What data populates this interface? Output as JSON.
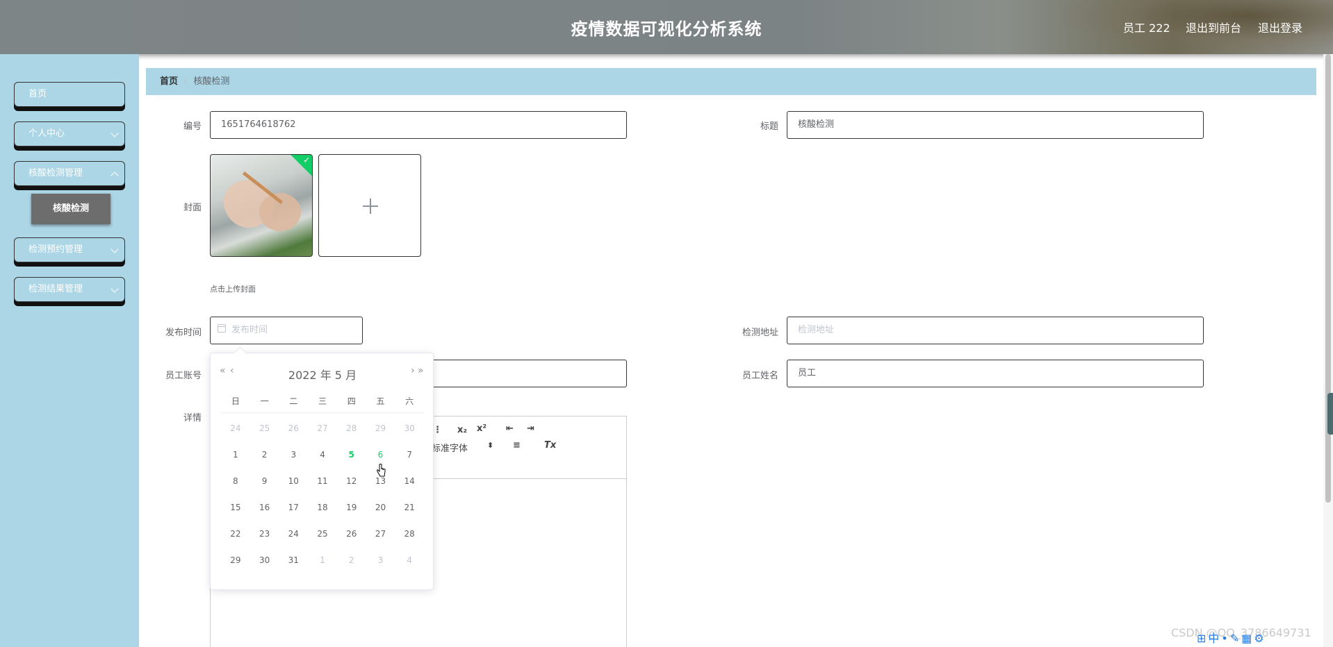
{
  "header": {
    "title": "疫情数据可视化分析系统",
    "user": "员工 222",
    "exit_front": "退出到前台",
    "logout": "退出登录"
  },
  "sidebar": {
    "items": [
      {
        "label": "首页"
      },
      {
        "label": "个人中心"
      },
      {
        "label": "核酸检测管理"
      },
      {
        "label": "检测预约管理"
      },
      {
        "label": "检测结果管理"
      }
    ],
    "active_sub": "核酸检测"
  },
  "breadcrumb": {
    "home": "首页",
    "current": "核酸检测"
  },
  "form": {
    "number_label": "编号",
    "number_value": "1651764618762",
    "title_label": "标题",
    "title_value": "核酸检测",
    "cover_label": "封面",
    "cover_tip": "点击上传封面",
    "publish_label": "发布时间",
    "publish_placeholder": "发布时间",
    "address_label": "检测地址",
    "address_placeholder": "检测地址",
    "account_label": "员工账号",
    "name_label": "员工姓名",
    "name_value": "员工",
    "detail_label": "详情"
  },
  "editor": {
    "font_select": "标准字体"
  },
  "datepicker": {
    "title": "2022 年  5 月",
    "weekdays": [
      "日",
      "一",
      "二",
      "三",
      "四",
      "五",
      "六"
    ],
    "weeks": [
      [
        "24",
        "25",
        "26",
        "27",
        "28",
        "29",
        "30"
      ],
      [
        "1",
        "2",
        "3",
        "4",
        "5",
        "6",
        "7"
      ],
      [
        "8",
        "9",
        "10",
        "11",
        "12",
        "13",
        "14"
      ],
      [
        "15",
        "16",
        "17",
        "18",
        "19",
        "20",
        "21"
      ],
      [
        "22",
        "23",
        "24",
        "25",
        "26",
        "27",
        "28"
      ],
      [
        "29",
        "30",
        "31",
        "1",
        "2",
        "3",
        "4"
      ]
    ],
    "today": "5"
  },
  "watermark": "CSDN @QQ_3786649731",
  "colors": {
    "accent": "#13ce66",
    "sidebar_bg": "#acd5e5"
  }
}
